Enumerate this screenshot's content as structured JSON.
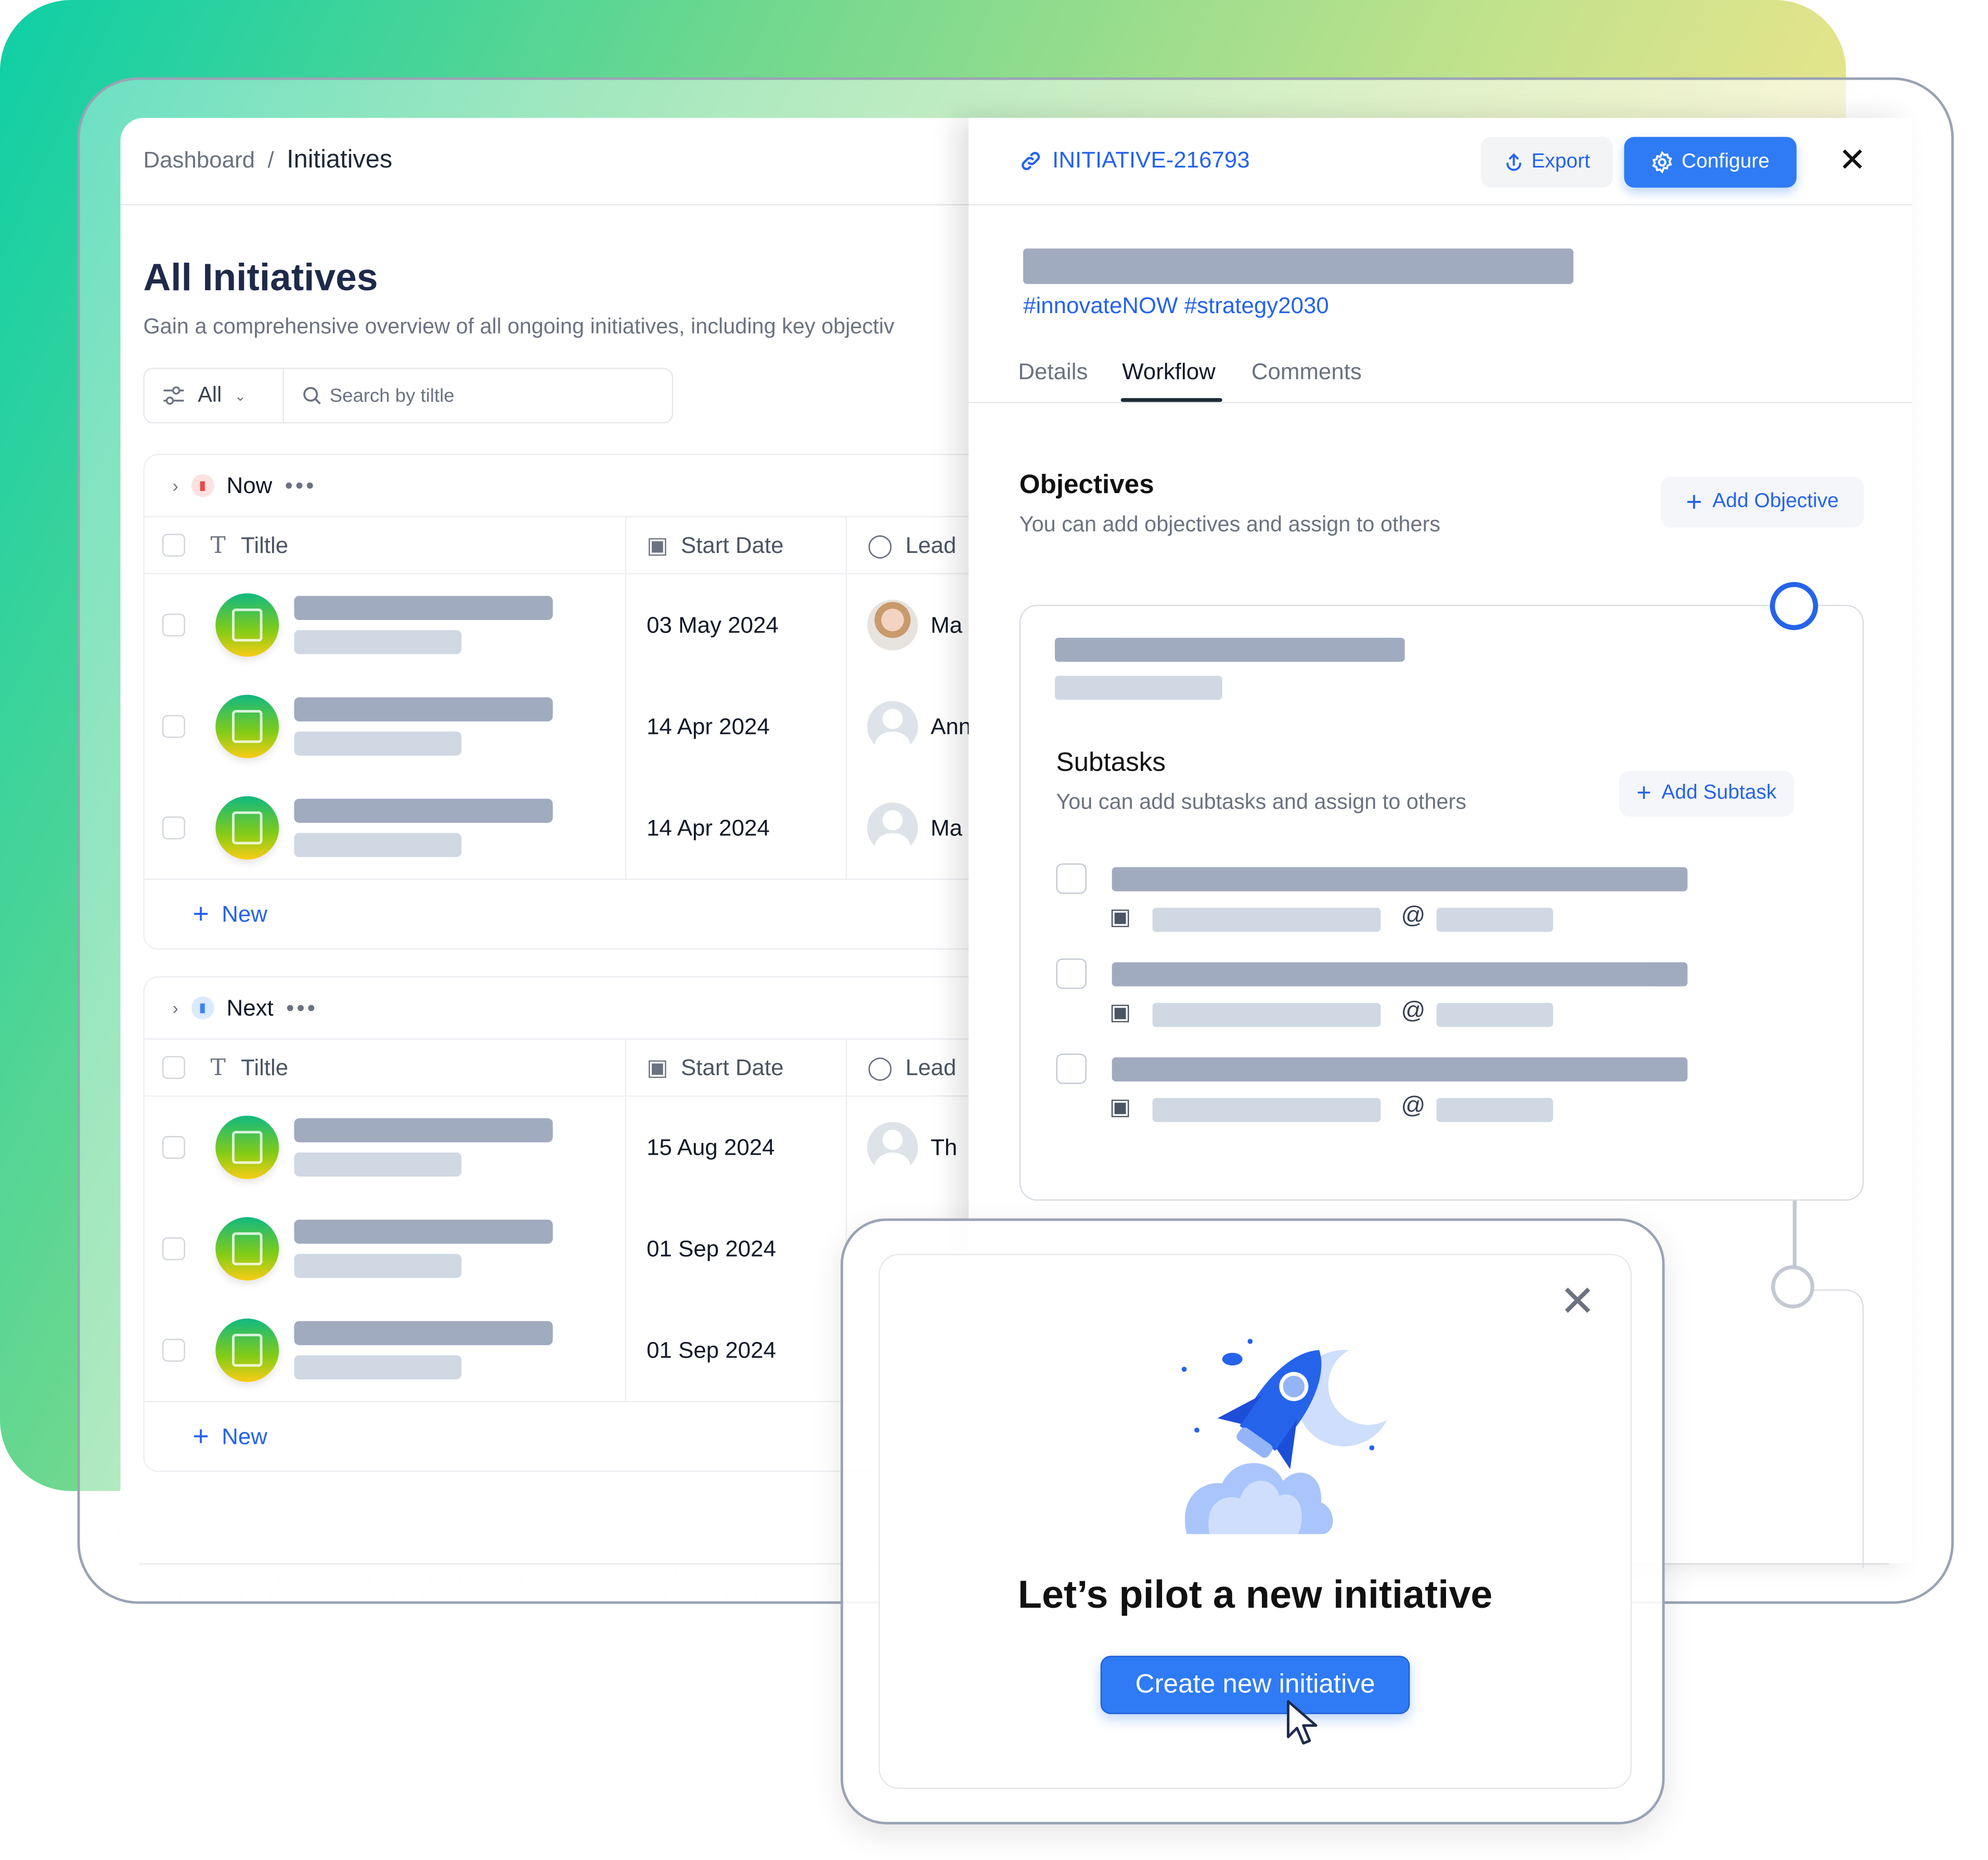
{
  "breadcrumb": {
    "parent": "Dashboard",
    "separator": "/",
    "current": "Initiatives"
  },
  "page": {
    "title": "All Initiatives",
    "subtitle": "Gain a comprehensive overview of all ongoing initiatives, including key objectiv"
  },
  "toolbar": {
    "filter_label": "All",
    "search_placeholder": "Search by tiltle"
  },
  "columns": {
    "title": "Tiltle",
    "start_date": "Start Date",
    "lead": "Lead"
  },
  "groups": [
    {
      "name": "Now",
      "icon_color": "#ef4444",
      "rows": [
        {
          "start_date": "03 May 2024",
          "lead": "Ma",
          "avatar": "photo"
        },
        {
          "start_date": "14 Apr 2024",
          "lead": "Ann",
          "avatar": "placeholder"
        },
        {
          "start_date": "14 Apr 2024",
          "lead": "Ma",
          "avatar": "placeholder"
        }
      ],
      "new_label": "New"
    },
    {
      "name": "Next",
      "icon_color": "#3b82f6",
      "rows": [
        {
          "start_date": "15 Aug 2024",
          "lead": "Th",
          "avatar": "placeholder"
        },
        {
          "start_date": "01 Sep 2024",
          "lead": "",
          "avatar": ""
        },
        {
          "start_date": "01 Sep 2024",
          "lead": "",
          "avatar": ""
        }
      ],
      "new_label": "New"
    }
  ],
  "detail": {
    "id": "INITIATIVE-216793",
    "export_label": "Export",
    "configure_label": "Configure",
    "tags": "#innovateNOW #strategy2030",
    "tabs": [
      {
        "label": "Details",
        "active": false
      },
      {
        "label": "Workflow",
        "active": true
      },
      {
        "label": "Comments",
        "active": false
      }
    ],
    "objectives": {
      "title": "Objectives",
      "subtitle": "You can add objectives and assign to others",
      "add_label": "Add Objective"
    },
    "subtasks": {
      "title": "Subtasks",
      "subtitle": "You can add subtasks and assign to others",
      "add_label": "Add Subtask",
      "at_symbol": "@"
    }
  },
  "modal": {
    "title": "Let’s pilot a new initiative",
    "button_label": "Create new initiative"
  },
  "colors": {
    "accent": "#2f7bf5",
    "link": "#2563eb"
  }
}
